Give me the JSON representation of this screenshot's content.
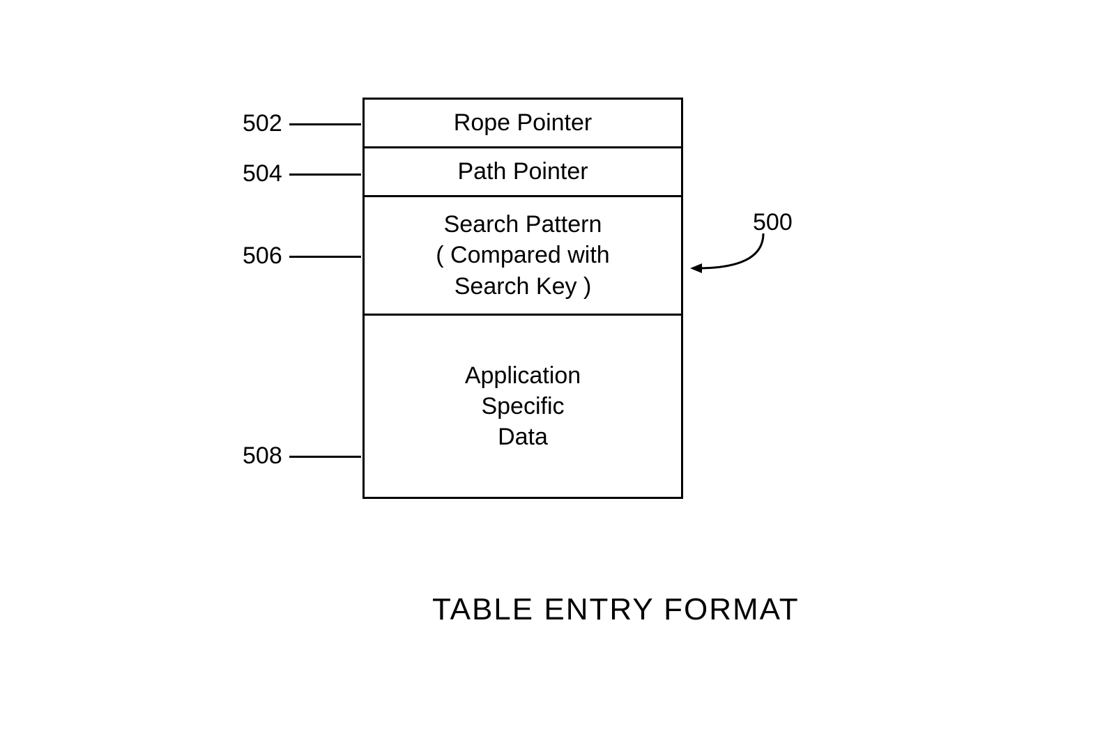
{
  "title": "TABLE ENTRY FORMAT",
  "refs": {
    "r500": "500",
    "r502": "502",
    "r504": "504",
    "r506": "506",
    "r508": "508"
  },
  "rows": {
    "row1": "Rope Pointer",
    "row2": "Path Pointer",
    "row3_line1": "Search Pattern",
    "row3_line2": "( Compared with",
    "row3_line3": "Search Key )",
    "row4_line1": "Application",
    "row4_line2": "Specific",
    "row4_line3": "Data"
  }
}
